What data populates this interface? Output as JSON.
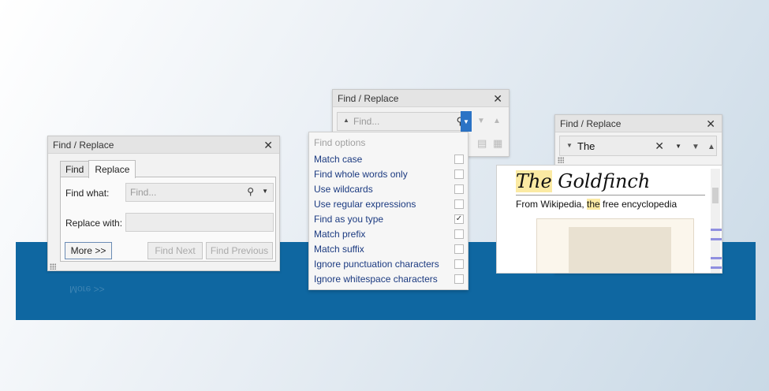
{
  "window_left": {
    "title": "Find / Replace",
    "close": "✕",
    "tabs": [
      "Find",
      "Replace"
    ],
    "find_label": "Find what:",
    "find_placeholder": "Find...",
    "replace_label": "Replace with:",
    "more_button": "More >>",
    "find_next": "Find Next",
    "find_previous": "Find Previous",
    "icons": [
      "search-icon",
      "dropdown-icon",
      "resize-grip-icon"
    ]
  },
  "window_middle": {
    "title": "Find / Replace",
    "close": "✕",
    "find_placeholder": "Find...",
    "dropdown_header": "Find options",
    "options": [
      {
        "label": "Match case",
        "checked": false
      },
      {
        "label": "Find whole words only",
        "checked": false
      },
      {
        "label": "Use wildcards",
        "checked": false
      },
      {
        "label": "Use regular expressions",
        "checked": false
      },
      {
        "label": "Find as you type",
        "checked": true
      },
      {
        "label": "Match prefix",
        "checked": false
      },
      {
        "label": "Match suffix",
        "checked": false
      },
      {
        "label": "Ignore punctuation characters",
        "checked": false
      },
      {
        "label": "Ignore whitespace characters",
        "checked": false
      }
    ],
    "check_mark": "✓"
  },
  "window_right": {
    "title": "Find / Replace",
    "close": "✕",
    "find_value": "The",
    "clear": "✕"
  },
  "document": {
    "title_highlight": "The",
    "title_rest": " Goldfinch",
    "subtitle_pre": "From Wikipedia, ",
    "subtitle_highlight": "the",
    "subtitle_post": " free encyclopedia"
  },
  "colors": {
    "band": "#0f67a1",
    "highlight": "#fbeaa3",
    "option_text": "#1b3a80",
    "accent": "#2b73c5"
  }
}
